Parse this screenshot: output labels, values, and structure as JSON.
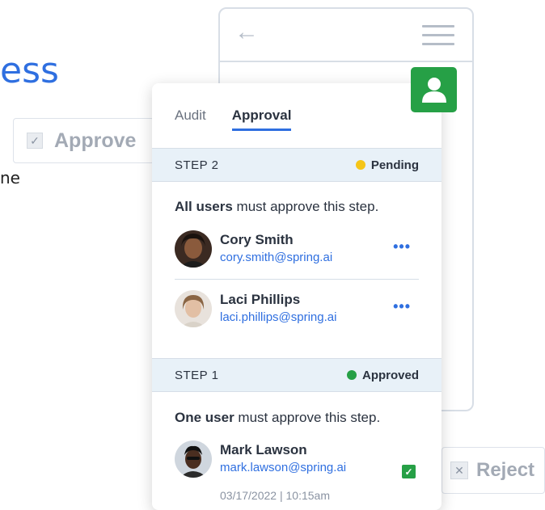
{
  "background": {
    "title_fragment": "ess",
    "text_fragment": "ne"
  },
  "approve_button": {
    "label": "Approve",
    "check_glyph": "✓"
  },
  "reject_button": {
    "label": "Reject",
    "check_glyph": "✕"
  },
  "phone": {
    "back_icon": "arrow-left-icon",
    "menu_icon": "menu-icon"
  },
  "tabs": [
    {
      "label": "Audit",
      "active": false
    },
    {
      "label": "Approval",
      "active": true
    }
  ],
  "steps": [
    {
      "label": "STEP 2",
      "status": "Pending",
      "status_color": "#f5c518",
      "rule_bold": "All users",
      "rule_rest": " must approve this step.",
      "users": [
        {
          "name": "Cory Smith",
          "email": "cory.smith@spring.ai",
          "action": "•••"
        },
        {
          "name": "Laci Phillips",
          "email": "laci.phillips@spring.ai",
          "action": "•••"
        }
      ]
    },
    {
      "label": "STEP 1",
      "status": "Approved",
      "status_color": "#26a046",
      "rule_bold": "One user",
      "rule_rest": " must approve this step.",
      "users": [
        {
          "name": "Mark Lawson",
          "email": "mark.lawson@spring.ai",
          "date": "03/17/2022 |",
          "time": "10:15am"
        }
      ]
    }
  ],
  "colors": {
    "accent": "#2f6fe0",
    "success": "#26a046",
    "pending": "#f5c518",
    "step_bg": "#e8f1f8"
  }
}
